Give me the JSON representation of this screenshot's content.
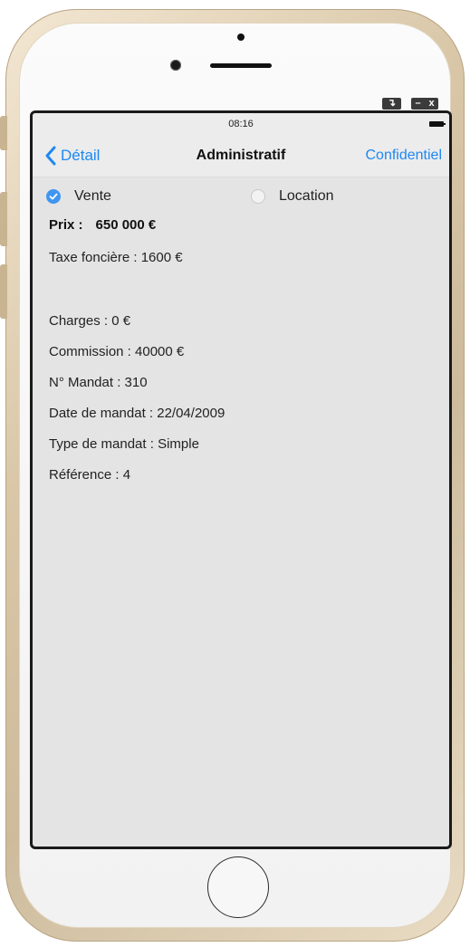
{
  "window_controls": {
    "restore": "↴",
    "minimize": "–",
    "close": "x"
  },
  "status": {
    "time": "08:16"
  },
  "nav": {
    "back_label": "Détail",
    "title": "Administratif",
    "right_label": "Confidentiel"
  },
  "transaction": {
    "options": [
      {
        "label": "Vente",
        "selected": true
      },
      {
        "label": "Location",
        "selected": false
      }
    ]
  },
  "details": {
    "price_label": "Prix :",
    "price_value": "650 000 €",
    "taxe": "Taxe foncière : 1600 €",
    "charges": "Charges : 0 €",
    "commission": "Commission : 40000 €",
    "mandat_no": "N° Mandat : 310",
    "mandat_date": "Date de mandat : 22/04/2009",
    "mandat_type": "Type de mandat : Simple",
    "reference": "Référence : 4"
  },
  "colors": {
    "accent": "#1e88f2",
    "radio_checked": "#3f96f0",
    "screen_bg": "#e4e4e4",
    "nav_bg": "#ececec"
  }
}
